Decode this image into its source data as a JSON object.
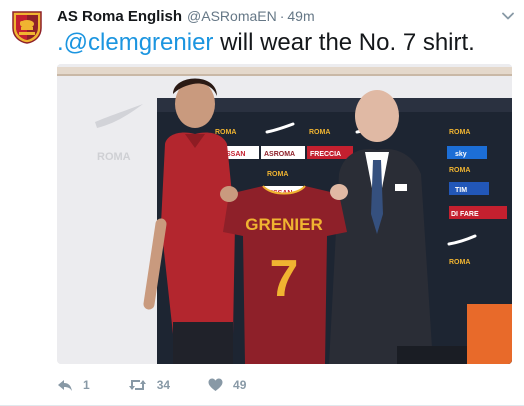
{
  "tweet": {
    "author_name": "AS Roma English",
    "author_handle": "@ASRomaEN",
    "separator": "·",
    "time": "49m",
    "text_mention": ".@clemgrenier",
    "text_rest": " will wear the No. 7 shirt.",
    "avatar_icon": "as-roma-crest",
    "menu_icon": "chevron-down-icon"
  },
  "photo": {
    "shirt_name": "GRENIER",
    "shirt_number": "7",
    "backdrop_sponsors": [
      "ROMA Cares",
      "NISSAN",
      "ASROMA.COM",
      "FRECCIAROSSA",
      "sky",
      "TIM",
      "DI FARE LA STORIA",
      "NISSAN"
    ],
    "backdrop_brand": "AS ROMA"
  },
  "actions": {
    "reply_count": "1",
    "retweet_count": "34",
    "like_count": "49"
  },
  "colors": {
    "mention": "#1b95e0",
    "shirt": "#8e2029",
    "shirt_lettering": "#f0b431",
    "backdrop": "#1d2532",
    "action_gray": "#8899a6"
  }
}
